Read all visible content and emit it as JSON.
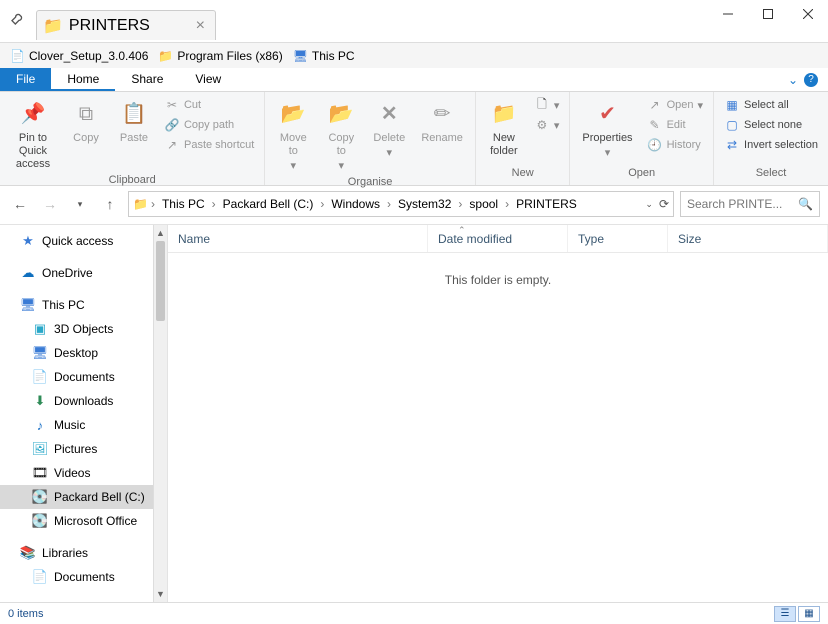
{
  "titlebar": {
    "tab_title": "PRINTERS"
  },
  "shortcuts": {
    "item1": "Clover_Setup_3.0.406",
    "item2": "Program Files (x86)",
    "item3": "This PC"
  },
  "menu": {
    "file": "File",
    "home": "Home",
    "share": "Share",
    "view": "View"
  },
  "ribbon": {
    "clipboard": {
      "pin": "Pin to Quick\naccess",
      "copy": "Copy",
      "paste": "Paste",
      "cut": "Cut",
      "copypath": "Copy path",
      "pasteshortcut": "Paste shortcut",
      "caption": "Clipboard"
    },
    "organise": {
      "moveto": "Move\nto",
      "copyto": "Copy\nto",
      "delete": "Delete",
      "rename": "Rename",
      "caption": "Organise"
    },
    "new": {
      "newfolder": "New\nfolder",
      "caption": "New"
    },
    "open": {
      "properties": "Properties",
      "open": "Open",
      "edit": "Edit",
      "history": "History",
      "caption": "Open"
    },
    "select": {
      "selectall": "Select all",
      "selectnone": "Select none",
      "invert": "Invert selection",
      "caption": "Select"
    }
  },
  "breadcrumb": {
    "p0": "This PC",
    "p1": "Packard Bell (C:)",
    "p2": "Windows",
    "p3": "System32",
    "p4": "spool",
    "p5": "PRINTERS"
  },
  "search": {
    "placeholder": "Search PRINTE..."
  },
  "columns": {
    "name": "Name",
    "date": "Date modified",
    "type": "Type",
    "size": "Size"
  },
  "empty": "This folder is empty.",
  "sidebar": {
    "quickaccess": "Quick access",
    "onedrive": "OneDrive",
    "thispc": "This PC",
    "threed": "3D Objects",
    "desktop": "Desktop",
    "documents": "Documents",
    "downloads": "Downloads",
    "music": "Music",
    "pictures": "Pictures",
    "videos": "Videos",
    "packard": "Packard Bell (C:)",
    "msoffice": "Microsoft Office",
    "libraries": "Libraries",
    "docslib": "Documents"
  },
  "status": {
    "items": "0 items"
  }
}
